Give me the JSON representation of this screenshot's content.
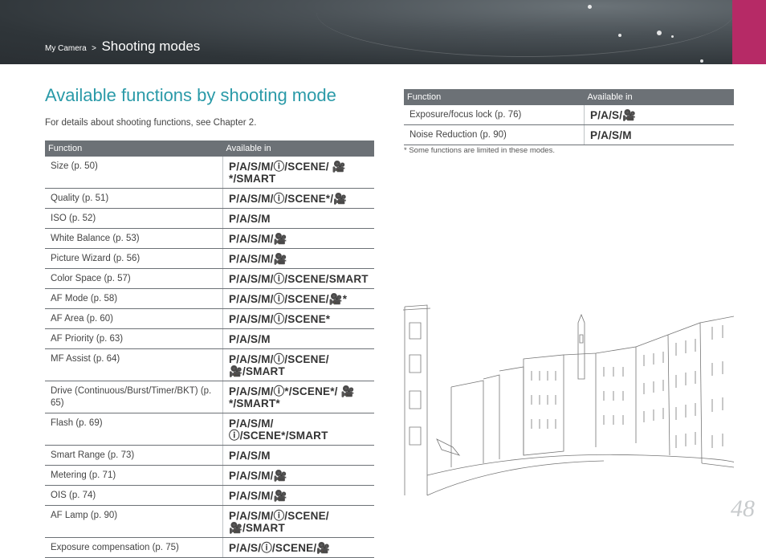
{
  "header": {
    "breadcrumb_parent": "My Camera",
    "breadcrumb_sep": ">",
    "breadcrumb_current": "Shooting modes",
    "accent_color": "#b62a66"
  },
  "title": "Available functions by shooting mode",
  "intro": "For details about shooting functions, see Chapter 2.",
  "table_left": {
    "headers": [
      "Function",
      "Available in"
    ],
    "rows": [
      {
        "function": "Size (p. 50)",
        "modes": "P/A/S/M/ⓘ/SCENE/ 🎥*/SMART"
      },
      {
        "function": "Quality (p. 51)",
        "modes": "P/A/S/M/ⓘ/SCENE*/🎥"
      },
      {
        "function": "ISO (p. 52)",
        "modes": "P/A/S/M"
      },
      {
        "function": "White Balance (p. 53)",
        "modes": "P/A/S/M/🎥"
      },
      {
        "function": "Picture Wizard (p. 56)",
        "modes": "P/A/S/M/🎥"
      },
      {
        "function": "Color Space (p. 57)",
        "modes": "P/A/S/M/ⓘ/SCENE/SMART"
      },
      {
        "function": "AF Mode (p. 58)",
        "modes": "P/A/S/M/ⓘ/SCENE/🎥*"
      },
      {
        "function": "AF Area (p. 60)",
        "modes": "P/A/S/M/ⓘ/SCENE*"
      },
      {
        "function": "AF Priority (p. 63)",
        "modes": "P/A/S/M"
      },
      {
        "function": "MF Assist (p. 64)",
        "modes": "P/A/S/M/ⓘ/SCENE/🎥/SMART"
      },
      {
        "function": "Drive (Continuous/Burst/Timer/BKT) (p. 65)",
        "modes": "P/A/S/M/ⓘ*/SCENE*/ 🎥*/SMART*"
      },
      {
        "function": "Flash (p. 69)",
        "modes": "P/A/S/M/ⓘ/SCENE*/SMART"
      },
      {
        "function": "Smart Range (p. 73)",
        "modes": "P/A/S/M"
      },
      {
        "function": "Metering (p. 71)",
        "modes": "P/A/S/M/🎥"
      },
      {
        "function": "OIS (p. 74)",
        "modes": "P/A/S/M/🎥"
      },
      {
        "function": "AF Lamp (p. 90)",
        "modes": "P/A/S/M/ⓘ/SCENE/🎥/SMART"
      },
      {
        "function": "Exposure compensation (p. 75)",
        "modes": "P/A/S/ⓘ/SCENE/🎥"
      }
    ]
  },
  "table_right": {
    "headers": [
      "Function",
      "Available in"
    ],
    "rows": [
      {
        "function": "Exposure/focus lock  (p. 76)",
        "modes": "P/A/S/🎥"
      },
      {
        "function": "Noise Reduction (p. 90)",
        "modes": "P/A/S/M"
      }
    ]
  },
  "note": "* Some functions are limited in these modes.",
  "page_number": "48"
}
